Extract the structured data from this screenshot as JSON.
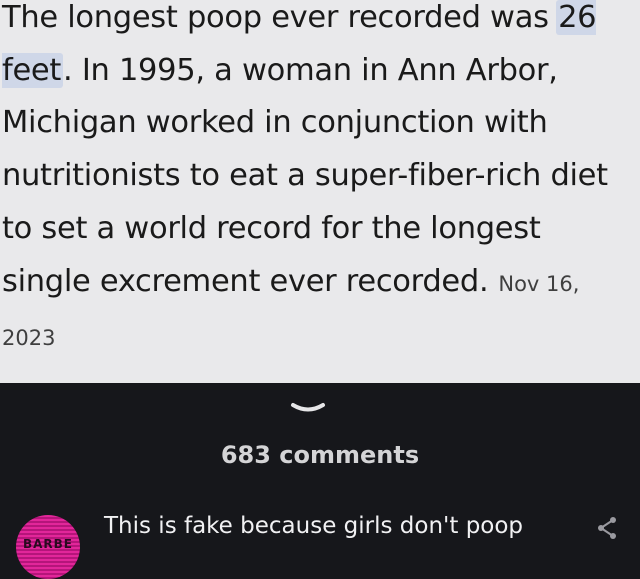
{
  "snippet": {
    "text_before": "The longest poop ever recorded was ",
    "highlight": "26 feet",
    "text_after": ". In 1995, a woman in Ann Arbor, Michigan worked in conjunction with nutritionists to eat a super-fiber-rich diet to set a world record for the longest single excrement ever recorded.",
    "date": "Nov 16, 2023"
  },
  "comments": {
    "count_label": "683 comments",
    "collapse_icon": "chevron-down-icon",
    "items": [
      {
        "avatar_text": "BARBE",
        "text": "This is fake because girls don't poop",
        "share_icon": "share-icon"
      }
    ]
  },
  "colors": {
    "snippet_background": "#e9e9eb",
    "highlight": "#cfd7e8",
    "dark_background": "#16171b",
    "avatar_pink": "#e2269a"
  }
}
